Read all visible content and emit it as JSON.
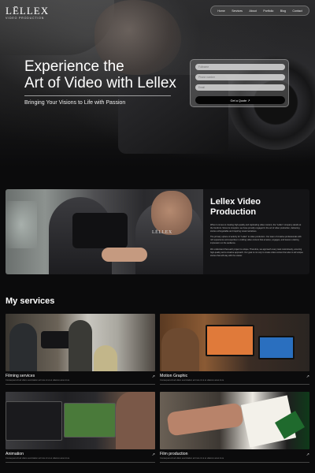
{
  "header": {
    "logo": "LĒLLEX",
    "logo_sub": "VIDEO PRODUCTION",
    "nav": [
      "Home",
      "Services",
      "About",
      "Portfolio",
      "Blog",
      "Contact"
    ]
  },
  "hero": {
    "title_line1": "Experience the",
    "title_line2": "Art of Video with Lellex",
    "subtitle": "Bringing Your Visions to Life with Passion",
    "form": {
      "fullname_placeholder": "Fullname",
      "phone_placeholder": "Phone number",
      "email_placeholder": "Email",
      "submit_label": "Get a Quote",
      "submit_arrow": "↗"
    }
  },
  "about": {
    "image_logo": "LĒLLEX",
    "title_line1": "Lellex Video",
    "title_line2": "Production",
    "paragraph1": "When it comes to creating high-quality and captivating video content, the \"Lellex\" company stands at the forefront. Since its inception, we have proudly engaged in the art of video production, delivering stories unforgettable and inspiring visual narratives.",
    "paragraph2": "The primary sphere of activity for \"Lellex\" is video production. Our team of creative professionals with rich experience and expertise in crafting video content that amazes, engages, and leaves a lasting impression on the audience.",
    "paragraph3": "We understand that each project is unique. Therefore, we approach every task meticulously, ensuring high-quality and a creative approach. Our goal is not only to create video content but also to tell unique stories that will stay with the viewer."
  },
  "services": {
    "title": "My services",
    "items": [
      {
        "name": "Filming services",
        "desc": "Consequat elit ad ullam exercitation ad irure id ut et ullamco amet irure",
        "arrow": "↗"
      },
      {
        "name": "Motion Graphic",
        "desc": "Consequat elit ad ullam exercitation ad irure id ut et ullamco amet irure",
        "arrow": "↗"
      },
      {
        "name": "Animation",
        "desc": "Consequat elit ad ullam exercitation ad irure id ut et ullamco amet irure",
        "arrow": "↗"
      },
      {
        "name": "Film production",
        "desc": "Consequat elit ad ullam exercitation ad irure id ut et ullamco amet irure",
        "arrow": "↗"
      }
    ]
  }
}
